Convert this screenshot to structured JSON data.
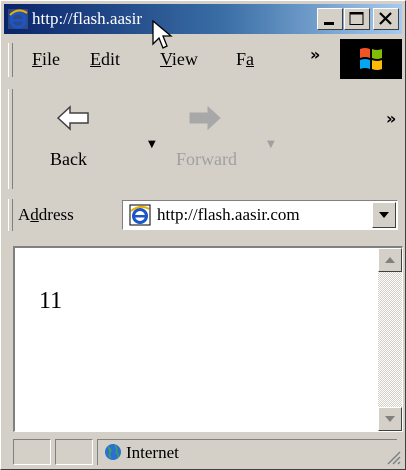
{
  "window": {
    "title": "http://flash.aasir",
    "controls": {
      "minimize": "minimize-icon",
      "maximize": "maximize-icon",
      "close": "close-icon"
    }
  },
  "menu": {
    "items": [
      {
        "label": "File",
        "accel": "F",
        "rest": "ile"
      },
      {
        "label": "Edit",
        "accel": "E",
        "rest": "dit"
      },
      {
        "label": "View",
        "accel": "V",
        "rest": "iew"
      },
      {
        "label": "Fa",
        "accel": "F",
        "rest": "a"
      }
    ],
    "overflow": "»"
  },
  "toolbar": {
    "back_label": "Back",
    "forward_label": "Forward",
    "overflow": "»"
  },
  "address": {
    "label_pre": "A",
    "label_accel": "d",
    "label_post": "dress",
    "value": "http://flash.aasir.com"
  },
  "content": {
    "text": "11"
  },
  "status": {
    "zone": "Internet"
  },
  "colors": {
    "titlebar_start": "#0a246a",
    "titlebar_end": "#a6caf0",
    "face": "#d4d0c8"
  }
}
